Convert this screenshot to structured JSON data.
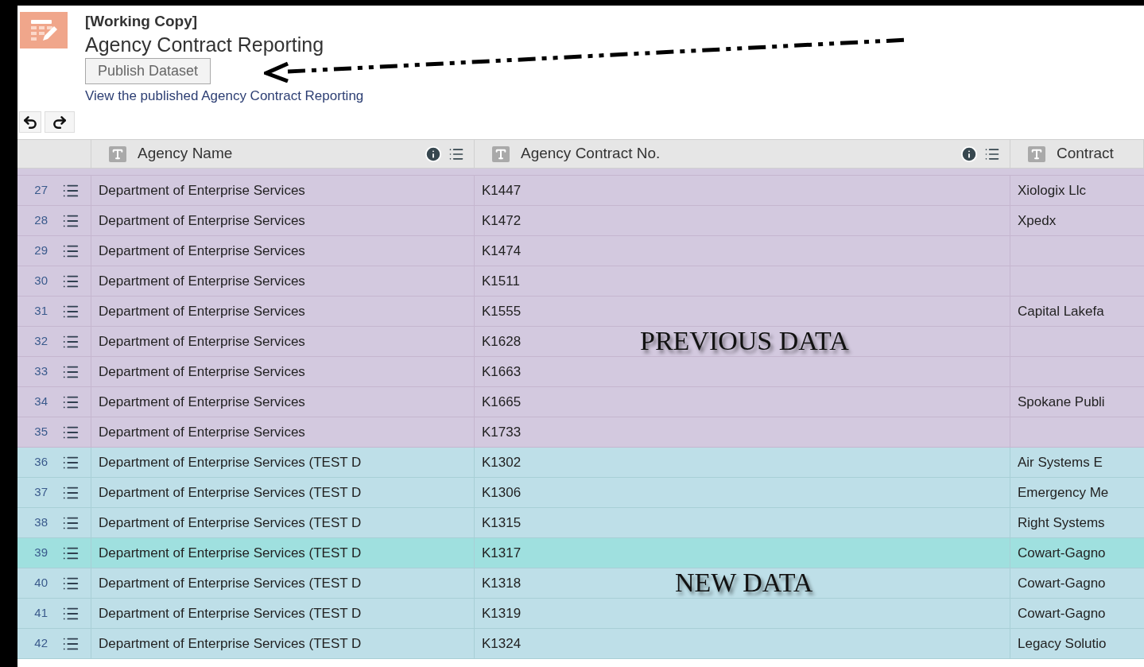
{
  "document": {
    "status": "[Working Copy]",
    "title": "Agency Contract Reporting",
    "publish_button": "Publish Dataset",
    "link": "View the published Agency Contract Reporting"
  },
  "annotations": [
    "PREVIOUS DATA",
    "NEW DATA"
  ],
  "table": {
    "columns": [
      {
        "label": "Agency Name",
        "info_icon": true
      },
      {
        "label": "Agency Contract No.",
        "info_icon": true
      },
      {
        "label": "Contract",
        "info_icon": false
      }
    ],
    "rows": [
      {
        "number": "27",
        "agency": "Department of Enterprise Services",
        "contract_no": "K1447",
        "contractor": "Xiologix Llc",
        "kind": "previous",
        "selected": false
      },
      {
        "number": "28",
        "agency": "Department of Enterprise Services",
        "contract_no": "K1472",
        "contractor": "Xpedx",
        "kind": "previous",
        "selected": false
      },
      {
        "number": "29",
        "agency": "Department of Enterprise Services",
        "contract_no": "K1474",
        "kind": "previous",
        "selected": false
      },
      {
        "number": "30",
        "agency": "Department of Enterprise Services",
        "contract_no": "K1511",
        "kind": "previous",
        "selected": false
      },
      {
        "number": "31",
        "agency": "Department of Enterprise Services",
        "contract_no": "K1555",
        "contractor": "Capital Lakefa",
        "kind": "previous",
        "selected": false
      },
      {
        "number": "32",
        "agency": "Department of Enterprise Services",
        "contract_no": "K1628",
        "kind": "previous",
        "selected": false
      },
      {
        "number": "33",
        "agency": "Department of Enterprise Services",
        "contract_no": "K1663",
        "kind": "previous",
        "selected": false
      },
      {
        "number": "34",
        "agency": "Department of Enterprise Services",
        "contract_no": "K1665",
        "contractor": "Spokane Publi",
        "kind": "previous",
        "selected": false
      },
      {
        "number": "35",
        "agency": "Department of Enterprise Services",
        "contract_no": "K1733",
        "kind": "previous",
        "selected": false
      },
      {
        "number": "36",
        "agency": "Department of Enterprise Services (TEST D",
        "contract_no": "K1302",
        "contractor": "Air Systems E",
        "kind": "new",
        "selected": false
      },
      {
        "number": "37",
        "agency": "Department of Enterprise Services (TEST D",
        "contract_no": "K1306",
        "contractor": "Emergency Me",
        "kind": "new",
        "selected": false
      },
      {
        "number": "38",
        "agency": "Department of Enterprise Services (TEST D",
        "contract_no": "K1315",
        "contractor": "Right Systems",
        "kind": "new",
        "selected": false
      },
      {
        "number": "39",
        "agency": "Department of Enterprise Services (TEST D",
        "contract_no": "K1317",
        "contractor": "Cowart-Gagno",
        "kind": "new",
        "selected": true
      },
      {
        "number": "40",
        "agency": "Department of Enterprise Services (TEST D",
        "contract_no": "K1318",
        "contractor": "Cowart-Gagno",
        "kind": "new",
        "selected": false
      },
      {
        "number": "41",
        "agency": "Department of Enterprise Services (TEST D",
        "contract_no": "K1319",
        "contractor": "Cowart-Gagno",
        "kind": "new",
        "selected": false
      },
      {
        "number": "42",
        "agency": "Department of Enterprise Services (TEST D",
        "contract_no": "K1324",
        "contractor": "Legacy Solutio",
        "kind": "new",
        "selected": false
      }
    ]
  }
}
